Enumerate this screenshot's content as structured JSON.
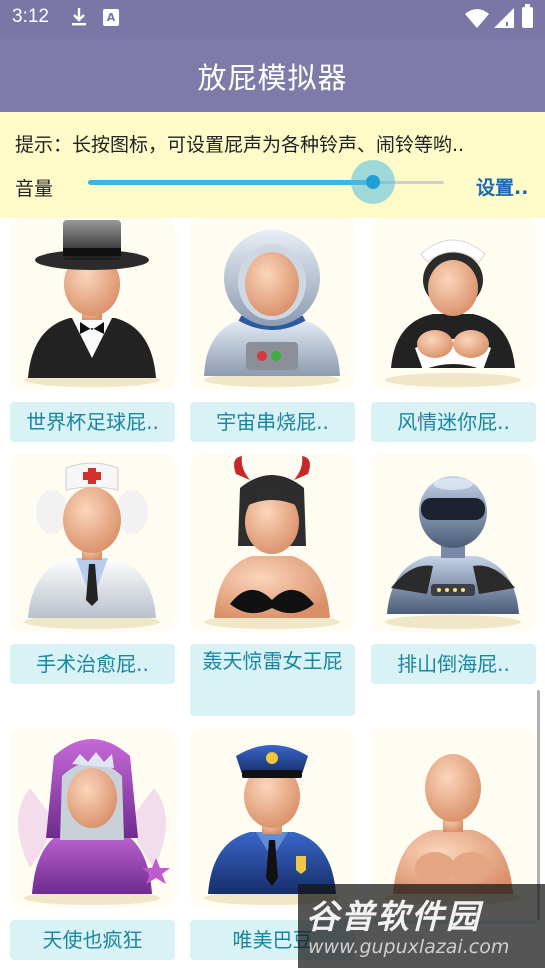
{
  "status_bar": {
    "time": "3:12",
    "download_icon": "download-icon",
    "notification_icon": "a-box-icon",
    "notification_letter": "A",
    "wifi_icon": "wifi-icon",
    "signal_icon": "signal-icon",
    "battery_icon": "battery-icon"
  },
  "app_bar": {
    "title": "放屁模拟器"
  },
  "tip_panel": {
    "tip_text": "提示：长按图标，可设置屁声为各种铃声、闹铃等哟..",
    "volume_label": "音量",
    "volume_level": 0.8,
    "settings_label": "设置..",
    "colors": {
      "track": "#cfcfcf",
      "fill": "#3cb4e0",
      "thumb": "#1f9fd3"
    }
  },
  "grid": {
    "items": [
      {
        "label": "世界杯足球屁..",
        "icon": "top-hat-gentleman-icon"
      },
      {
        "label": "宇宙串烧屁..",
        "icon": "astronaut-icon"
      },
      {
        "label": "风情迷你屁..",
        "icon": "maid-icon"
      },
      {
        "label": "手术治愈屁..",
        "icon": "doctor-icon"
      },
      {
        "label": "轰天惊雷女王屁",
        "icon": "devil-woman-icon"
      },
      {
        "label": "排山倒海屁..",
        "icon": "robot-icon"
      },
      {
        "label": "天使也疯狂",
        "icon": "fairy-icon"
      },
      {
        "label": "唯美巴豆",
        "icon": "police-icon"
      },
      {
        "label": "",
        "icon": "nude-bust-icon"
      }
    ]
  },
  "watermark": {
    "brand": "谷普软件园",
    "url": "www.gupuxlazai.com"
  }
}
